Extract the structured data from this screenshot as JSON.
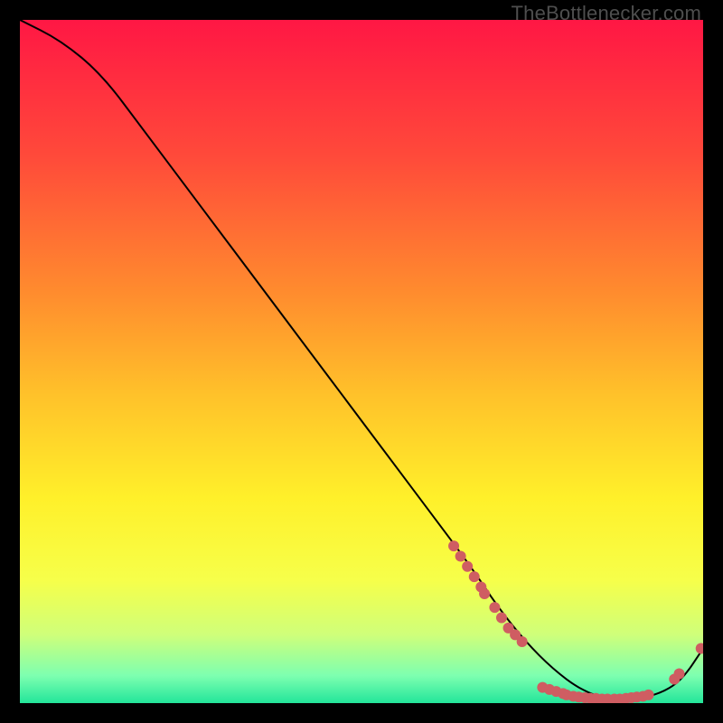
{
  "watermark": "TheBottlenecker.com",
  "chart_data": {
    "type": "line",
    "title": "",
    "xlabel": "",
    "ylabel": "",
    "xlim": [
      0,
      100
    ],
    "ylim": [
      0,
      100
    ],
    "grid": false,
    "series": [
      {
        "name": "curve",
        "color": "#000000",
        "x": [
          0,
          6,
          12,
          18,
          24,
          30,
          36,
          42,
          48,
          54,
          60,
          66,
          70,
          74,
          78,
          82,
          86,
          90,
          94,
          97,
          100
        ],
        "y": [
          100,
          97,
          92,
          84,
          76,
          68,
          60,
          52,
          44,
          36,
          28,
          20,
          14,
          9,
          5,
          2,
          0.5,
          0.5,
          1.5,
          3.5,
          8
        ]
      }
    ],
    "markers": [
      {
        "x": 63.5,
        "y": 23.0
      },
      {
        "x": 64.5,
        "y": 21.5
      },
      {
        "x": 65.5,
        "y": 20.0
      },
      {
        "x": 66.5,
        "y": 18.5
      },
      {
        "x": 67.5,
        "y": 17.0
      },
      {
        "x": 68.0,
        "y": 16.0
      },
      {
        "x": 69.5,
        "y": 14.0
      },
      {
        "x": 70.5,
        "y": 12.5
      },
      {
        "x": 71.5,
        "y": 11.0
      },
      {
        "x": 72.5,
        "y": 10.0
      },
      {
        "x": 73.5,
        "y": 9.0
      },
      {
        "x": 76.5,
        "y": 2.3
      },
      {
        "x": 77.5,
        "y": 2.0
      },
      {
        "x": 78.5,
        "y": 1.7
      },
      {
        "x": 79.5,
        "y": 1.4
      },
      {
        "x": 80.0,
        "y": 1.2
      },
      {
        "x": 81.0,
        "y": 1.0
      },
      {
        "x": 81.8,
        "y": 0.9
      },
      {
        "x": 82.7,
        "y": 0.8
      },
      {
        "x": 83.5,
        "y": 0.7
      },
      {
        "x": 84.3,
        "y": 0.7
      },
      {
        "x": 85.2,
        "y": 0.6
      },
      {
        "x": 86.0,
        "y": 0.6
      },
      {
        "x": 87.0,
        "y": 0.6
      },
      {
        "x": 87.8,
        "y": 0.6
      },
      {
        "x": 88.7,
        "y": 0.7
      },
      {
        "x": 89.5,
        "y": 0.8
      },
      {
        "x": 90.3,
        "y": 0.9
      },
      {
        "x": 91.2,
        "y": 1.0
      },
      {
        "x": 92.0,
        "y": 1.2
      },
      {
        "x": 95.8,
        "y": 3.5
      },
      {
        "x": 96.5,
        "y": 4.3
      },
      {
        "x": 99.7,
        "y": 8.0
      }
    ],
    "marker_color": "#cf5d62",
    "background": {
      "gradient_stops": [
        {
          "offset": 0.0,
          "color": "#ff1744"
        },
        {
          "offset": 0.2,
          "color": "#ff4a3a"
        },
        {
          "offset": 0.4,
          "color": "#ff8c2e"
        },
        {
          "offset": 0.55,
          "color": "#ffc22a"
        },
        {
          "offset": 0.7,
          "color": "#fff02a"
        },
        {
          "offset": 0.82,
          "color": "#f6ff4a"
        },
        {
          "offset": 0.9,
          "color": "#cfff7a"
        },
        {
          "offset": 0.96,
          "color": "#7dffb0"
        },
        {
          "offset": 1.0,
          "color": "#23e59a"
        }
      ]
    }
  }
}
